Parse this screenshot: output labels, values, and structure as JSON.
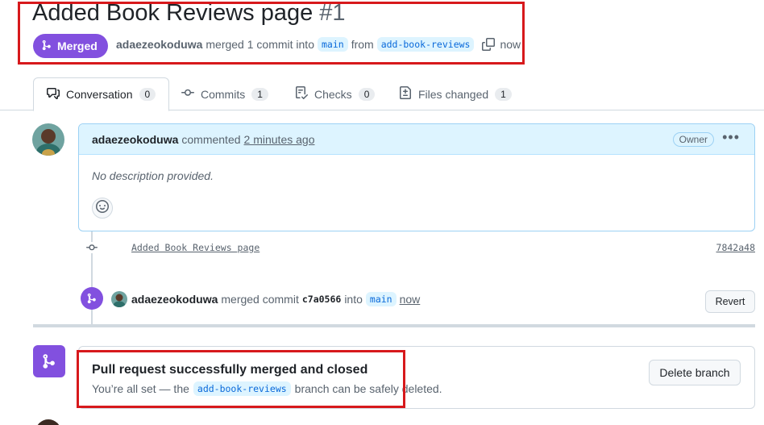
{
  "pr": {
    "title": "Added Book Reviews page",
    "number": "#1",
    "state_label": "Merged",
    "author": "adaezeokoduwa",
    "merged_text": "merged 1 commit into",
    "base_branch": "main",
    "from_text": "from",
    "head_branch": "add-book-reviews",
    "when": "now"
  },
  "tabs": [
    {
      "label": "Conversation",
      "count": "0",
      "icon": "comment-discussion-icon"
    },
    {
      "label": "Commits",
      "count": "1",
      "icon": "git-commit-icon"
    },
    {
      "label": "Checks",
      "count": "0",
      "icon": "checklist-icon"
    },
    {
      "label": "Files changed",
      "count": "1",
      "icon": "file-diff-icon"
    }
  ],
  "comment": {
    "author": "adaezeokoduwa",
    "action": "commented",
    "time": "2 minutes ago",
    "role": "Owner",
    "body": "No description provided."
  },
  "commit": {
    "message": "Added Book Reviews page",
    "sha": "7842a48"
  },
  "merge_event": {
    "author": "adaezeokoduwa",
    "action": "merged commit",
    "sha": "c7a0566",
    "into": "into",
    "branch": "main",
    "when": "now",
    "revert_label": "Revert"
  },
  "merged_box": {
    "title": "Pull request successfully merged and closed",
    "sub_prefix": "You’re all set — the",
    "branch": "add-book-reviews",
    "sub_suffix": "branch can be safely deleted.",
    "delete_label": "Delete branch"
  },
  "colors": {
    "merged_purple": "#8250df",
    "highlight_red": "#d7191c",
    "branch_bg": "#ddf4ff",
    "branch_fg": "#0969da"
  }
}
